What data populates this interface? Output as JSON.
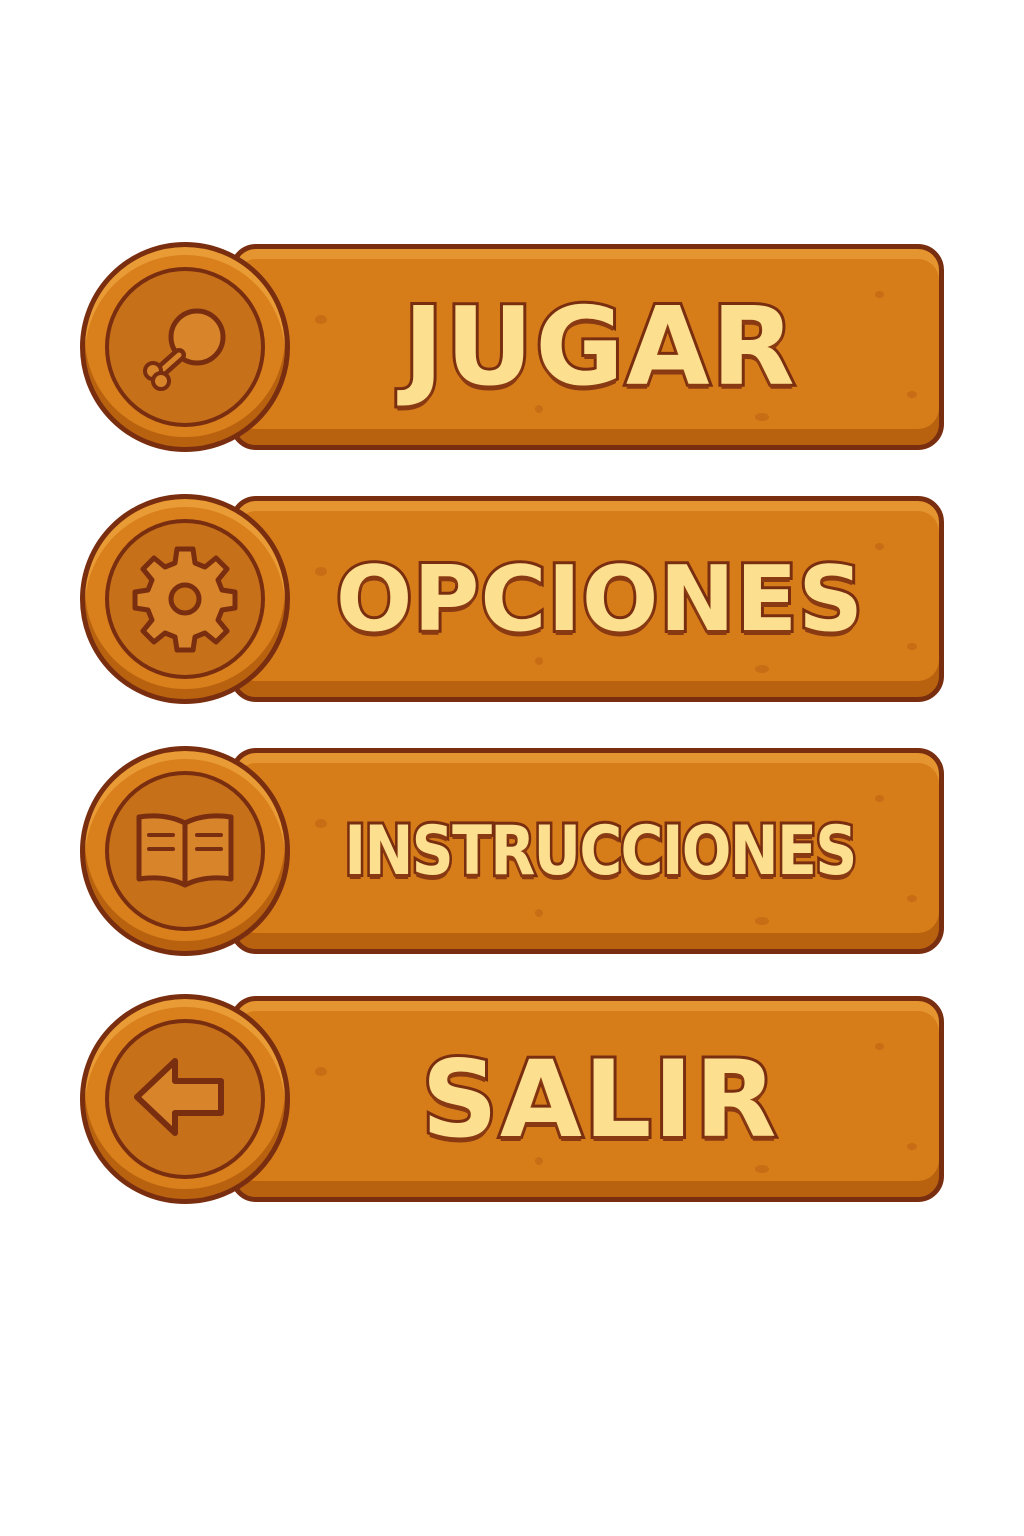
{
  "menu": {
    "items": [
      {
        "label": "JUGAR",
        "icon": "drumstick-icon"
      },
      {
        "label": "OPCIONES",
        "icon": "gear-icon"
      },
      {
        "label": "INSTRUCCIONES",
        "icon": "book-icon"
      },
      {
        "label": "SALIR",
        "icon": "arrow-left-icon"
      }
    ]
  },
  "colors": {
    "button_fill": "#d67d1a",
    "button_outline": "#7a2e10",
    "label_text": "#fde08f"
  }
}
